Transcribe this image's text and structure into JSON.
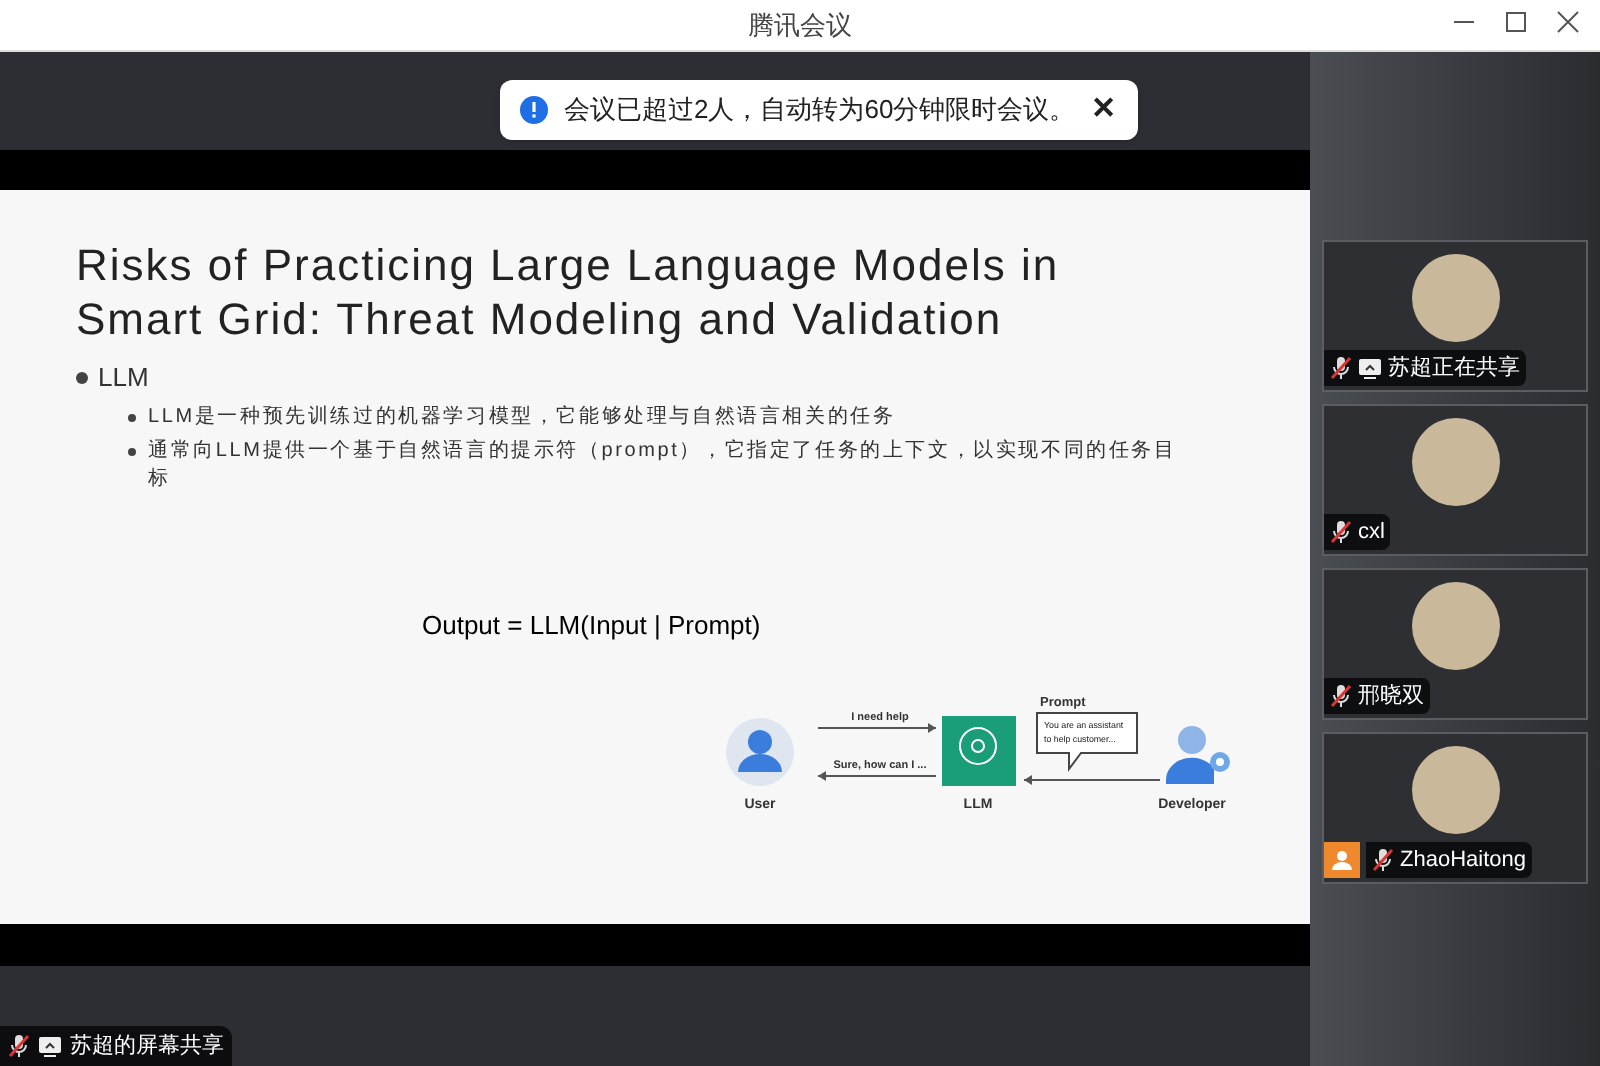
{
  "window": {
    "title": "腾讯会议"
  },
  "notification": {
    "text": "会议已超过2人，自动转为60分钟限时会议。",
    "close": "✕"
  },
  "slide": {
    "title": "Risks of Practicing Large Language Models in Smart Grid: Threat Modeling and Validation",
    "bullets": [
      {
        "text": "LLM",
        "children": [
          {
            "text": "LLM是一种预先训练过的机器学习模型，它能够处理与自然语言相关的任务"
          },
          {
            "text": "通常向LLM提供一个基于自然语言的提示符（prompt），它指定了任务的上下文，以实现不同的任务目标"
          }
        ]
      }
    ],
    "formula": "Output = LLM(Input | Prompt)",
    "diagram": {
      "user": "User",
      "llm": "LLM",
      "developer": "Developer",
      "request": "I need help",
      "response": "Sure, how can I ...",
      "prompt_title": "Prompt",
      "prompt_text": "You are an assistant to help customer..."
    }
  },
  "participants": [
    {
      "name": "苏超正在共享",
      "sharing": true,
      "user_badge": false
    },
    {
      "name": "cxl",
      "sharing": false,
      "user_badge": false
    },
    {
      "name": "邢晓双",
      "sharing": false,
      "user_badge": false
    },
    {
      "name": "ZhaoHaitong",
      "sharing": false,
      "user_badge": true
    }
  ],
  "screen_share_label": {
    "text": "苏超的屏幕共享",
    "sharing": true
  }
}
